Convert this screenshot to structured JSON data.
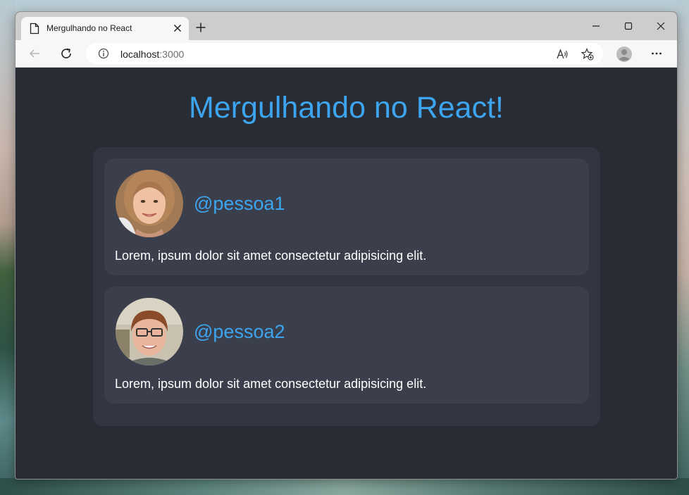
{
  "browser": {
    "tab_title": "Mergulhando no React",
    "address": {
      "host": "localhost",
      "port": ":3000"
    }
  },
  "icons": {
    "tab": "document-icon",
    "close": "close-icon",
    "new_tab": "plus-icon",
    "back": "back-arrow-icon",
    "refresh": "refresh-icon",
    "info": "info-icon",
    "read_aloud": "read-aloud-icon",
    "favorite": "add-favorite-icon",
    "profile": "profile-icon",
    "more": "more-icon"
  },
  "page": {
    "title": "Mergulhando no React!",
    "posts": [
      {
        "handle": "@pessoa1",
        "bio": "Lorem, ipsum dolor sit amet consectetur adipisicing elit."
      },
      {
        "handle": "@pessoa2",
        "bio": "Lorem, ipsum dolor sit amet consectetur adipisicing elit."
      }
    ]
  },
  "colors": {
    "accent": "#3da5f0",
    "page_bg": "#282c34",
    "container_bg": "#313640",
    "card_bg": "#3a3f4b"
  }
}
